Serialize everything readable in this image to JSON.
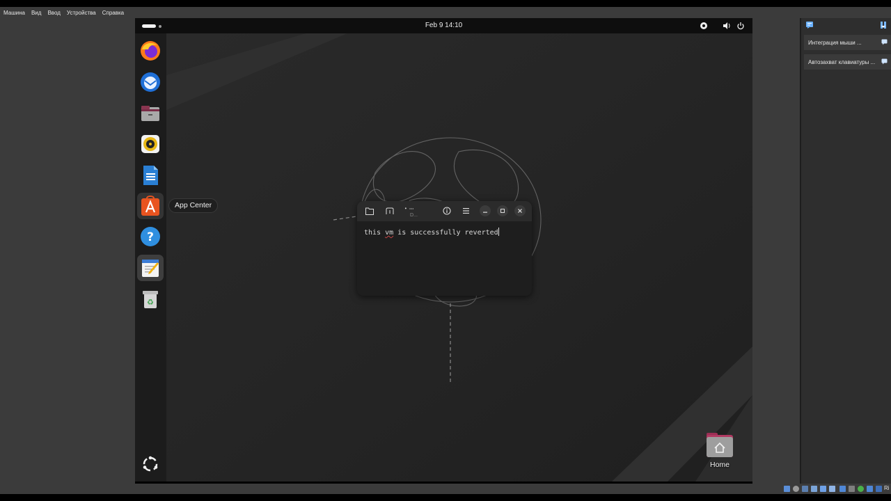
{
  "host_menu": [
    "Машина",
    "Вид",
    "Ввод",
    "Устройства",
    "Справка"
  ],
  "guest": {
    "clock": "Feb 9  14:10",
    "dock": {
      "items": [
        {
          "name": "firefox",
          "icon": "firefox-icon"
        },
        {
          "name": "thunderbird",
          "icon": "thunderbird-icon"
        },
        {
          "name": "files",
          "icon": "files-icon"
        },
        {
          "name": "rhythmbox",
          "icon": "rhythmbox-icon"
        },
        {
          "name": "libreoffice-writer",
          "icon": "writer-icon"
        },
        {
          "name": "app-center",
          "icon": "app-center-icon"
        },
        {
          "name": "help",
          "icon": "help-icon"
        },
        {
          "name": "text-editor",
          "icon": "text-editor-icon"
        },
        {
          "name": "trash",
          "icon": "trash-icon"
        }
      ],
      "tooltip": "App Center",
      "show_apps_icon": "show-apps-icon"
    },
    "editor": {
      "doc_title": "D...",
      "content_before": "this ",
      "content_misspelled": "vm",
      "content_after": " is successfully reverted"
    },
    "desktop": {
      "home_label": "Home"
    }
  },
  "side_panel": {
    "rows": [
      "Интеграция мыши ...",
      "Автозахват клавиатуры ..."
    ]
  },
  "status_bar": {
    "host_key": "Ri"
  },
  "colors": {
    "guest_background": "#262626",
    "topbar": "#0e0e0e",
    "dock": "#1c1c1c",
    "accent_orange": "#e95420"
  }
}
